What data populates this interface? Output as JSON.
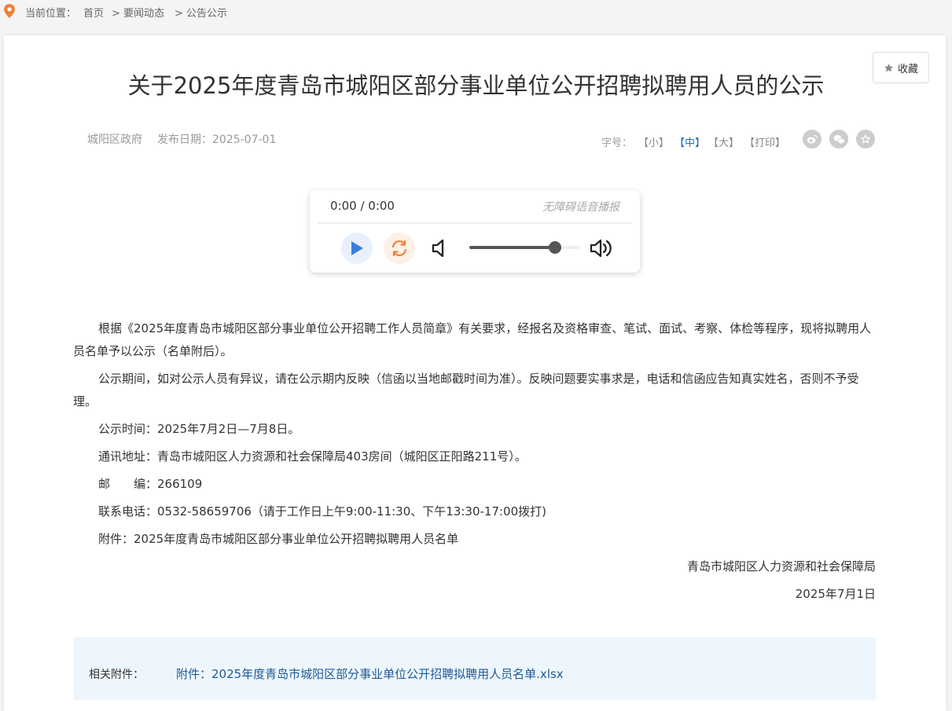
{
  "breadcrumb": {
    "prefix": "当前位置：",
    "items": [
      "首页",
      "> 要闻动态",
      "> 公告公示"
    ]
  },
  "toolbar": {
    "favorite_label": "收藏"
  },
  "article": {
    "title": "关于2025年度青岛市城阳区部分事业单位公开招聘拟聘用人员的公示",
    "source": "城阳区政府",
    "publish_label": "发布日期：",
    "publish_date": "2025-07-01",
    "font_size_label": "字号：",
    "font_options": [
      "【小】",
      "【中】",
      "【大】"
    ],
    "print_label": "【打印】",
    "paragraphs": [
      "根据《2025年度青岛市城阳区部分事业单位公开招聘工作人员简章》有关要求，经报名及资格审查、笔试、面试、考察、体检等程序，现将拟聘用人员名单予以公示（名单附后）。",
      "公示期间，如对公示人员有异议，请在公示期内反映（信函以当地邮戳时间为准）。反映问题要实事求是，电话和信函应告知真实姓名，否则不予受理。",
      "公示时间：2025年7月2日—7月8日。",
      "通讯地址：青岛市城阳区人力资源和社会保障局403房间（城阳区正阳路211号）。",
      "邮　　编：266109",
      "联系电话：0532-58659706（请于工作日上午9:00-11:30、下午13:30-17:00拨打)",
      "附件：2025年度青岛市城阳区部分事业单位公开招聘拟聘用人员名单"
    ],
    "signature_org": "青岛市城阳区人力资源和社会保障局",
    "signature_date": "2025年7月1日"
  },
  "share_icons": [
    "weibo-icon",
    "wechat-icon",
    "star-icon"
  ],
  "player": {
    "time": "0:00 / 0:00",
    "label": "无障碍语音播报",
    "volume": 0.78
  },
  "attachments": {
    "label": "相关附件：",
    "files": [
      "附件：2025年度青岛市城阳区部分事业单位公开招聘拟聘用人员名单.xlsx"
    ]
  },
  "colors": {
    "accent": "#1e6fbd",
    "play": "#3b7ddd",
    "loop": "#f0813a"
  }
}
